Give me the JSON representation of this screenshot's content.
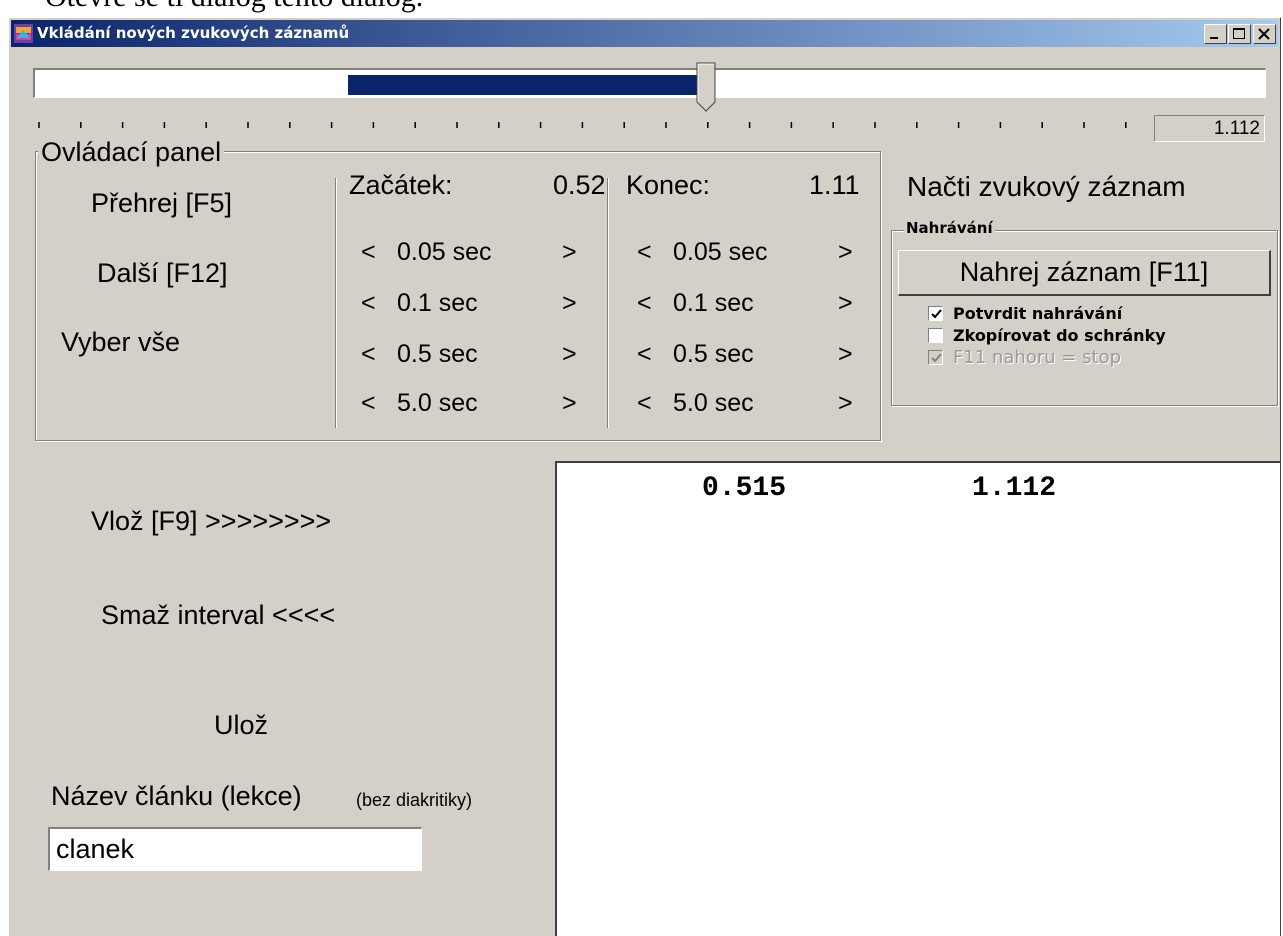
{
  "document_text": "Otevře se ti dialog tento dialog.",
  "window": {
    "title": "Vkládání nových zvukových záznamů",
    "buttons": [
      "minimize",
      "maximize",
      "close"
    ]
  },
  "slider": {
    "selection_start_fraction": 0.2545,
    "selection_end_fraction": 0.5475,
    "position_fraction": 0.5475,
    "current_time": "1.112"
  },
  "control_panel": {
    "legend": "Ovládací panel",
    "play_button": "Přehrej [F5]",
    "next_button": "Další [F12]",
    "select_all_button": "Vyber vše",
    "start_label": "Začátek:",
    "start_value": "0.52",
    "end_label": "Konec:",
    "end_value": "1.11",
    "steps": [
      "0.05 sec",
      "0.1 sec",
      "0.5 sec",
      "5.0 sec"
    ],
    "decrease_symbol": "<",
    "increase_symbol": ">"
  },
  "load_button": "Načti zvukový záznam",
  "recording": {
    "legend": "Nahrávání",
    "record_button": "Nahrej záznam [F11]",
    "confirm_recording": {
      "label": "Potvrdit nahrávání",
      "checked": true
    },
    "copy_to_clipboard": {
      "label": "Zkopírovat do schránky",
      "checked": false
    },
    "f11_up_stop": {
      "label": "F11 nahoru = stop",
      "checked": true,
      "disabled": true
    }
  },
  "actions": {
    "insert": "Vlož [F9]  >>>>>>>>",
    "delete_interval": "Smaž interval <<<<",
    "save": "Ulož"
  },
  "article": {
    "label": "Název článku (lekce)",
    "hint": "(bez diakritiky)",
    "value": "clanek"
  },
  "output": {
    "start": "0.515",
    "end": "1.112"
  }
}
